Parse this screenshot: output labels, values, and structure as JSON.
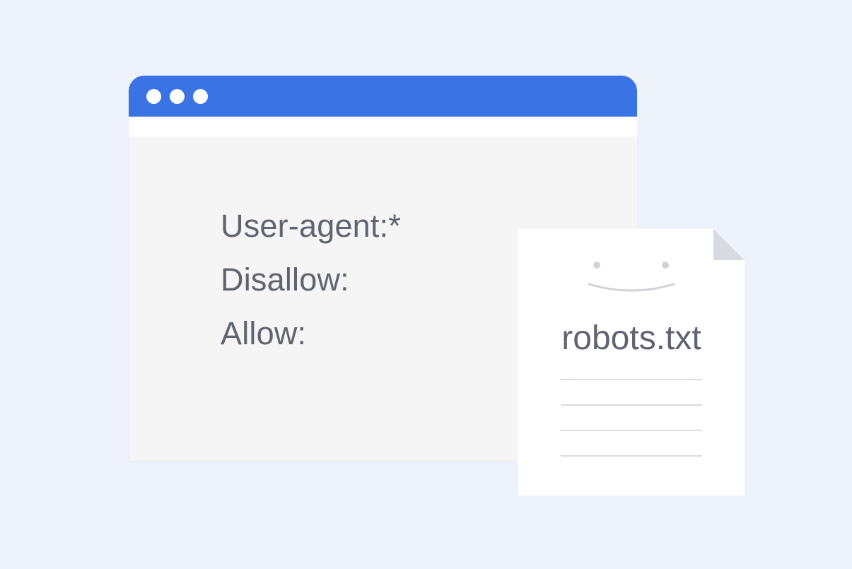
{
  "browser": {
    "title_bar_color": "#3a73e3",
    "window_controls": [
      "dot",
      "dot",
      "dot"
    ],
    "code": [
      "User-agent:*",
      "Disallow:",
      "Allow:"
    ]
  },
  "file": {
    "name": "robots.txt",
    "icon": "smiley-face-icon",
    "ruled_lines": 4
  }
}
